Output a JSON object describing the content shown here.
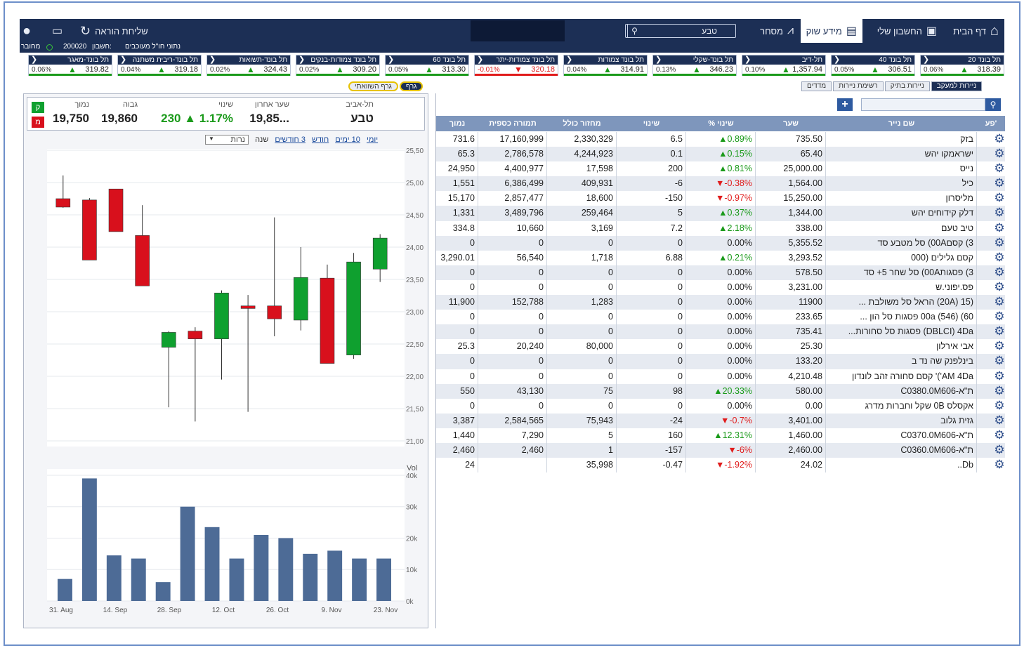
{
  "nav": {
    "home": "דף הבית",
    "account": "החשבון שלי",
    "market": "מידע שוק",
    "trade": "מסחר",
    "search_value": "טבע",
    "send_order": "שליחת הוראה"
  },
  "subbar": {
    "text": "נתוני חו\"ל מעוכבים",
    "account_label": "חשבון:",
    "account": "200020",
    "status": "מחובר"
  },
  "indices": [
    {
      "name": "תל בונד 20",
      "value": "318.39",
      "change": "0.06%",
      "dir": "up"
    },
    {
      "name": "תל בונד 40",
      "value": "306.51",
      "change": "0.05%",
      "dir": "up"
    },
    {
      "name": "תל-דיב",
      "value": "1,357.94",
      "change": "0.10%",
      "dir": "up"
    },
    {
      "name": "תל בונד-שקלי",
      "value": "346.23",
      "change": "0.13%",
      "dir": "up"
    },
    {
      "name": "תל בונד צמודות",
      "value": "314.91",
      "change": "0.04%",
      "dir": "up"
    },
    {
      "name": "תל בונד צמודות-יתר",
      "value": "320.18",
      "change": "-0.01%",
      "dir": "dn"
    },
    {
      "name": "תל בונד 60",
      "value": "313.30",
      "change": "0.05%",
      "dir": "up"
    },
    {
      "name": "תל בונד צמודות-בנקים",
      "value": "309.20",
      "change": "0.02%",
      "dir": "up"
    },
    {
      "name": "תל בונד-תשואות",
      "value": "324.43",
      "change": "0.02%",
      "dir": "up"
    },
    {
      "name": "תל בונד-ריבית משתנה",
      "value": "319.18",
      "change": "0.04%",
      "dir": "up"
    },
    {
      "name": "תל בונד-מאגר",
      "value": "319.82",
      "change": "0.06%",
      "dir": "up"
    }
  ],
  "right_tabs": [
    "ניירות למעקב",
    "ניירות בתיק",
    "רשימת ניירות",
    "מדדים"
  ],
  "left_tabs": [
    "גרף",
    "גרף השוואתי"
  ],
  "quote": {
    "exchange": "תל-אביב",
    "name": "טבע",
    "last_label": "שער אחרון",
    "last": "19,85...",
    "chg_label": "שינוי",
    "chg": "230",
    "chg_pct": "1.17%",
    "high_label": "גבוה",
    "high": "19,860",
    "low_label": "נמוך",
    "low": "19,750",
    "buy": "ק",
    "sell": "מ"
  },
  "periods": {
    "items": [
      "יומי",
      "10 ימים",
      "חודש",
      "3 חודשים",
      "שנה"
    ],
    "type": "נרות"
  },
  "chart_data": {
    "type": "candlestick",
    "yticks": [
      "25,50",
      "25,00",
      "24,50",
      "24,00",
      "23,50",
      "23,00",
      "22,50",
      "22,00",
      "21,50",
      "21,00"
    ],
    "ylim": [
      21000,
      25500
    ],
    "candles": [
      {
        "o": 24750,
        "c": 24620,
        "h": 25110,
        "l": 24610
      },
      {
        "o": 24730,
        "c": 23800,
        "h": 24760,
        "l": 23800
      },
      {
        "o": 24900,
        "c": 24240,
        "h": 24900,
        "l": 24240
      },
      {
        "o": 24180,
        "c": 23400,
        "h": 24650,
        "l": 23400
      },
      {
        "o": 22450,
        "c": 22680,
        "h": 22700,
        "l": 21520
      },
      {
        "o": 22700,
        "c": 22580,
        "h": 22760,
        "l": 21300
      },
      {
        "o": 22580,
        "c": 23290,
        "h": 23330,
        "l": 21950
      },
      {
        "o": 23090,
        "c": 23050,
        "h": 23260,
        "l": 21450
      },
      {
        "o": 23090,
        "c": 22890,
        "h": 24460,
        "l": 22620
      },
      {
        "o": 22870,
        "c": 23530,
        "h": 24000,
        "l": 22710
      },
      {
        "o": 23520,
        "c": 22200,
        "h": 23730,
        "l": 22200
      },
      {
        "o": 22330,
        "c": 23770,
        "h": 23910,
        "l": 22270
      },
      {
        "o": 23660,
        "c": 24140,
        "h": 24200,
        "l": 23460
      }
    ],
    "vol_label": "Vol",
    "vol_ticks": [
      "40k",
      "30k",
      "20k",
      "10k",
      "0k"
    ],
    "volumes": [
      7000,
      39000,
      14500,
      13500,
      6000,
      30000,
      23500,
      13500,
      21000,
      20000,
      15000,
      16000,
      13500,
      13500
    ],
    "xticks": [
      "31. Aug",
      "14. Sep",
      "28. Sep",
      "12. Oct",
      "26. Oct",
      "9. Nov",
      "23. Nov"
    ]
  },
  "table": {
    "headers": [
      "פע'",
      "שם נייר",
      "שער",
      "% שינוי",
      "שינוי",
      "מחזור כולל",
      "תמורה כספית",
      "נמוך"
    ],
    "rows": [
      [
        "בזק",
        "735.50",
        "0.89%",
        "6.5",
        "2,330,329",
        "17,160,999",
        "731.6",
        "up"
      ],
      [
        "ישראמקו יהש",
        "65.40",
        "0.15%",
        "0.1",
        "4,244,923",
        "2,786,578",
        "65.3",
        "up"
      ],
      [
        "נייס",
        "25,000.00",
        "0.81%",
        "200",
        "17,598",
        "4,400,977",
        "24,950",
        "up"
      ],
      [
        "כיל",
        "1,564.00",
        "-0.38%",
        "-6",
        "409,931",
        "6,386,499",
        "1,551",
        "dn"
      ],
      [
        "מליסרון",
        "15,250.00",
        "-0.97%",
        "-150",
        "18,600",
        "2,857,477",
        "15,170",
        "dn"
      ],
      [
        "דלק קידוחים יהש",
        "1,344.00",
        "0.37%",
        "5",
        "259,464",
        "3,489,796",
        "1,331",
        "up"
      ],
      [
        "טיב טעם",
        "338.00",
        "2.18%",
        "7.2",
        "3,169",
        "10,660",
        "334.8",
        "up"
      ],
      [
        "3) קסם00A) סל מטבע סד",
        "5,355.52",
        "0.00%",
        "0",
        "0",
        "0",
        "0",
        ""
      ],
      [
        "קסם גלילים (000",
        "3,293.52",
        "0.21%",
        "6.88",
        "1,718",
        "56,540",
        "3,290.01",
        "up"
      ],
      [
        "3) פסגות00A) סל שחר 5+ סד",
        "578.50",
        "0.00%",
        "0",
        "0",
        "0",
        "0",
        ""
      ],
      [
        "פס.יפוני.ש",
        "3,231.00",
        "0.00%",
        "0",
        "0",
        "0",
        "0",
        ""
      ],
      [
        "(15 (20A) הראל סל משולבת ...",
        "11900",
        "0.00%",
        "0",
        "1,283",
        "152,788",
        "11,900",
        ""
      ],
      [
        "60) (546) 00a פסגות סל הון ...",
        "233.65",
        "0.00%",
        "0",
        "0",
        "0",
        "0",
        ""
      ],
      [
        "DBLCI) 4Da) פסגות סל סחורות...",
        "735.41",
        "0.00%",
        "0",
        "0",
        "0",
        "0",
        ""
      ],
      [
        "אבי אירלון",
        "25.30",
        "0.00%",
        "0",
        "80,000",
        "20,240",
        "25.3",
        ""
      ],
      [
        "בינלפנק שה נד ב",
        "133.20",
        "0.00%",
        "0",
        "0",
        "0",
        "0",
        ""
      ],
      [
        "AM 4Da')' קסם סחורה זהב לונדון",
        "4,210.48",
        "0.00%",
        "0",
        "0",
        "0",
        "0",
        ""
      ],
      [
        "ת\"א-C0380.0M606",
        "580.00",
        "20.33%",
        "98",
        "75",
        "43,130",
        "550",
        "up"
      ],
      [
        "אקסלס 0B שקל וחברות מדרג",
        "0.00",
        "0.00%",
        "0",
        "0",
        "0",
        "0",
        ""
      ],
      [
        "גזית גלוב",
        "3,401.00",
        "-0.7%",
        "-24",
        "75,943",
        "2,584,565",
        "3,387",
        "dn"
      ],
      [
        "ת\"א-C0370.0M606",
        "1,460.00",
        "12.31%",
        "160",
        "5",
        "7,290",
        "1,440",
        "up"
      ],
      [
        "ת\"א-C0360.0M606",
        "2,460.00",
        "-6%",
        "-157",
        "1",
        "2,460",
        "2,460",
        "dn"
      ],
      [
        "Db..",
        "24.02",
        "-1.92%",
        "-0.47",
        "35,998",
        "",
        "24",
        "dn"
      ]
    ]
  },
  "colors": {
    "nav": "#1c2f55",
    "header": "#7e96bc",
    "up": "#1a9a1a",
    "down": "#e01b1b",
    "bull": "#0fa02f",
    "bear": "#d8101c"
  }
}
